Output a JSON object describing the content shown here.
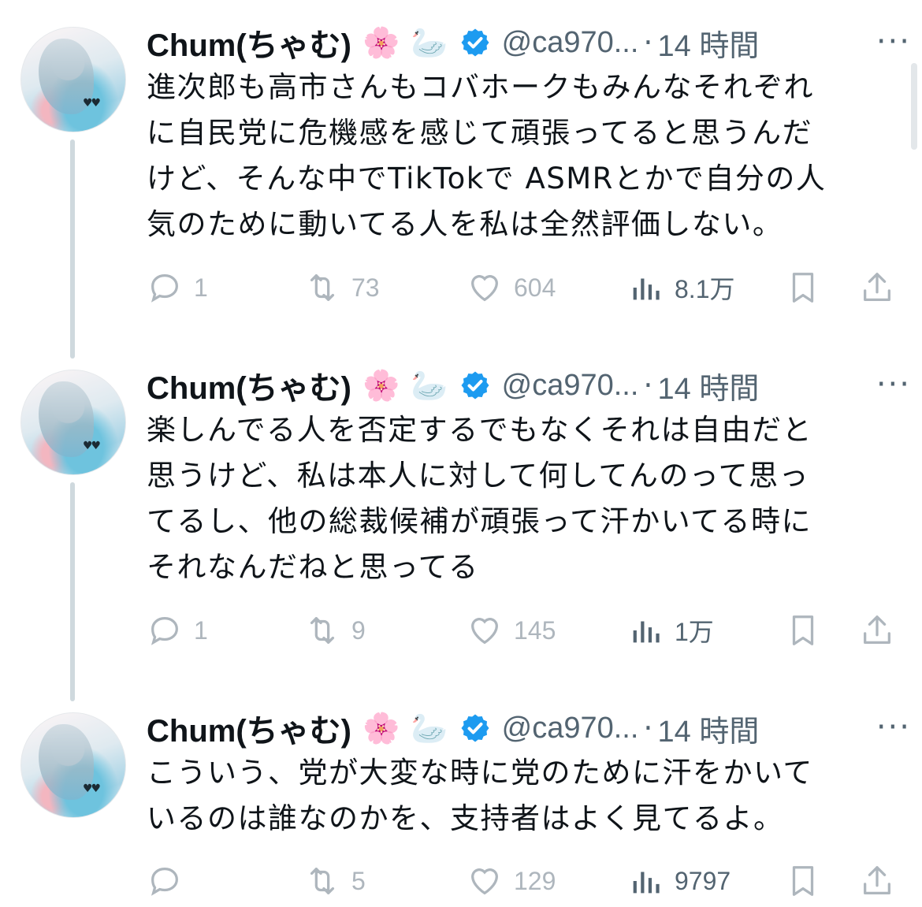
{
  "tweets": [
    {
      "name": "Chum(ちゃむ)",
      "emoji": "🌸",
      "emoji2": "🦢",
      "handle": "@ca970...",
      "separator": "·",
      "time": "14 時間",
      "more": "···",
      "text": "進次郎も高市さんもコバホークもみんなそれぞれ\nに自民党に危機感を感じて頑張ってると思うんだ\nけど、そんな中でTikTokで ASMRとかで自分の人\n気のために動いてる人を私は全然評価しない。",
      "replies": "1",
      "retweets": "73",
      "likes": "604",
      "views": "8.1万"
    },
    {
      "name": "Chum(ちゃむ)",
      "emoji": "🌸",
      "emoji2": "🦢",
      "handle": "@ca970...",
      "separator": "·",
      "time": "14 時間",
      "more": "···",
      "text": "楽しんでる人を否定するでもなくそれは自由だと\n思うけど、私は本人に対して何してんのって思っ\nてるし、他の総裁候補が頑張って汗かいてる時に\nそれなんだねと思ってる",
      "replies": "1",
      "retweets": "9",
      "likes": "145",
      "views": "1万"
    },
    {
      "name": "Chum(ちゃむ)",
      "emoji": "🌸",
      "emoji2": "🦢",
      "handle": "@ca970...",
      "separator": "·",
      "time": "14 時間",
      "more": "···",
      "text": "こういう、党が大変な時に党のために汗をかいて\nいるのは誰なのかを、支持者はよく見てるよ。",
      "replies": "",
      "retweets": "5",
      "likes": "129",
      "views": "9797"
    }
  ],
  "colors": {
    "verified_badge": "#1d9bf0",
    "secondary_text": "#536471",
    "faded_icon": "#aeb6bd",
    "thread_line": "#cfd9de"
  },
  "icons": [
    "reply-icon",
    "retweet-icon",
    "like-icon",
    "views-icon",
    "bookmark-icon",
    "share-icon",
    "verified-badge-icon",
    "more-icon"
  ]
}
